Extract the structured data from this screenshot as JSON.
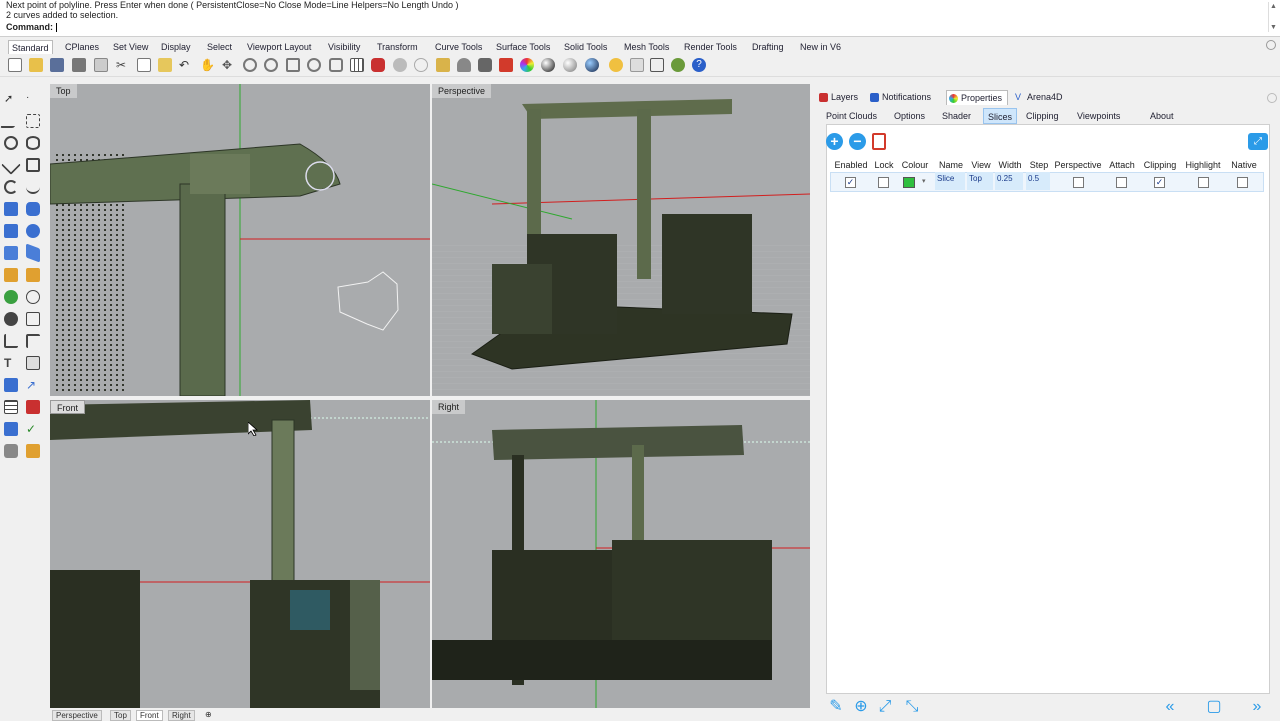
{
  "command_area": {
    "line1": "Next point of polyline. Press Enter when done ( PersistentClose=No  Close  Mode=Line  Helpers=No  Length  Undo )",
    "line2": "2 curves added to selection.",
    "prompt": "Command:"
  },
  "toolbar_tabs": [
    "Standard",
    "CPlanes",
    "Set View",
    "Display",
    "Select",
    "Viewport Layout",
    "Visibility",
    "Transform",
    "Curve Tools",
    "Surface Tools",
    "Solid Tools",
    "Mesh Tools",
    "Render Tools",
    "Drafting",
    "New in V6"
  ],
  "viewports": {
    "top": "Top",
    "perspective": "Perspective",
    "front": "Front",
    "right": "Right"
  },
  "bottom_tabs": [
    "Perspective",
    "Top",
    "Front",
    "Right"
  ],
  "panel": {
    "tabs": [
      "Layers",
      "Notifications",
      "Properties",
      "Arena4D"
    ],
    "subtabs": [
      "Point Clouds",
      "Options",
      "Shader",
      "Slices",
      "Clipping",
      "Viewpoints",
      "About"
    ],
    "active_subtab": "Slices",
    "columns": [
      "Enabled",
      "Lock",
      "Colour",
      "Name",
      "View",
      "Width",
      "Step",
      "Perspective",
      "Attach",
      "Clipping",
      "Highlight",
      "Native"
    ],
    "row": {
      "enabled": true,
      "lock": false,
      "colour": "#2fbf3f",
      "name": "Slice",
      "view": "Top",
      "width": "0.25",
      "step": "0.5",
      "perspective": false,
      "attach": false,
      "clipping": true,
      "highlight": false,
      "native": false
    }
  },
  "colors": {
    "accent": "#2b9be8",
    "viewport_bg": "#a9abad",
    "x_axis": "#d21e1e",
    "y_axis": "#2fa82f",
    "point_cloud": "#5f7050"
  }
}
